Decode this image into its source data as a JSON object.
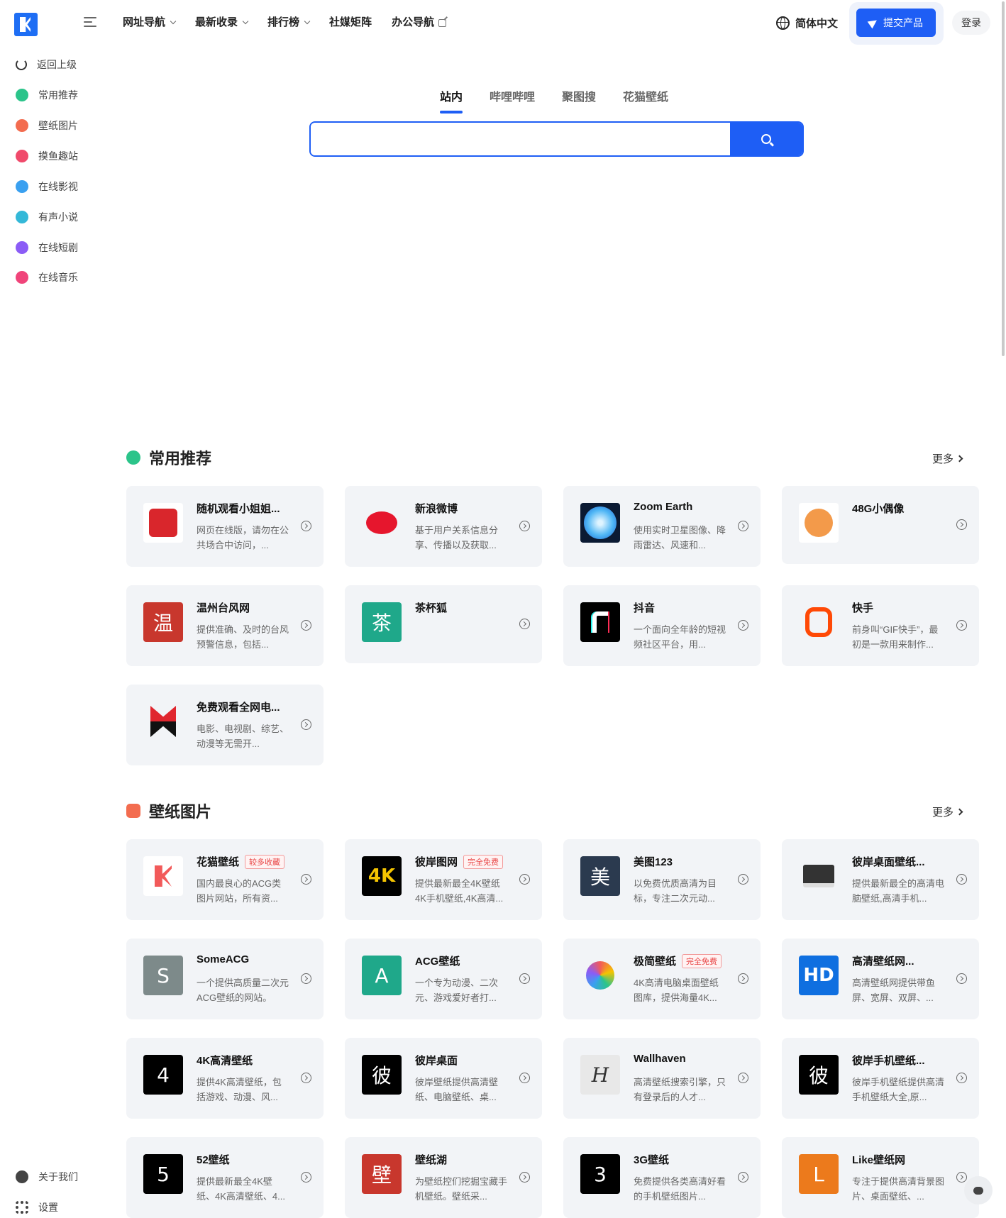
{
  "header": {
    "nav": [
      {
        "label": "网址导航",
        "type": "dropdown"
      },
      {
        "label": "最新收录",
        "type": "dropdown"
      },
      {
        "label": "排行榜",
        "type": "dropdown"
      },
      {
        "label": "社媒矩阵",
        "type": "plain"
      },
      {
        "label": "办公导航",
        "type": "external"
      }
    ],
    "language": "简体中文",
    "submit_label": "提交产品",
    "login_label": "登录"
  },
  "sidebar": {
    "items": [
      {
        "label": "返回上级",
        "icon": "back-arrow-icon",
        "color": "#333333"
      },
      {
        "label": "常用推荐",
        "icon": "verified-check-icon",
        "color": "#2bc48a"
      },
      {
        "label": "壁纸图片",
        "icon": "picture-icon",
        "color": "#f36c4f"
      },
      {
        "label": "摸鱼趣站",
        "icon": "fish-icon",
        "color": "#f04a6b"
      },
      {
        "label": "在线影视",
        "icon": "play-icon",
        "color": "#3aa0f0"
      },
      {
        "label": "有声小说",
        "icon": "chat-bubble-icon",
        "color": "#34b8d8"
      },
      {
        "label": "在线短剧",
        "icon": "tv-icon",
        "color": "#8b5cf6"
      },
      {
        "label": "在线音乐",
        "icon": "music-disc-icon",
        "color": "#f0447a"
      }
    ],
    "bottom": [
      {
        "label": "关于我们",
        "icon": "info-icon"
      },
      {
        "label": "设置",
        "icon": "gear-icon"
      }
    ]
  },
  "search": {
    "tabs": [
      "站内",
      "哔哩哔哩",
      "聚图搜",
      "花猫壁纸"
    ],
    "active_tab": 0,
    "placeholder": "",
    "value": ""
  },
  "sections": [
    {
      "title": "常用推荐",
      "icon": "verified-check-icon",
      "more_label": "更多",
      "cards": [
        {
          "title": "随机观看小姐姐...",
          "desc": "网页在线版，请勿在公共场合中访问，...",
          "icon_text": "",
          "icon_kind": "heart-app-icon",
          "icon_bg": "#ffffff"
        },
        {
          "title": "新浪微博",
          "desc": "基于用户关系信息分享、传播以及获取...",
          "icon_text": "",
          "icon_kind": "weibo-icon",
          "icon_bg": "#f2f4f7"
        },
        {
          "title": "Zoom Earth",
          "desc": "使用实时卫星图像、降雨雷达、风速和...",
          "icon_text": "",
          "icon_kind": "earth-swirl-icon",
          "icon_bg": "#0b1a33"
        },
        {
          "title": "48G小偶像",
          "desc": "",
          "icon_text": "",
          "icon_kind": "fox-mascot-icon",
          "icon_bg": "#ffffff"
        },
        {
          "title": "温州台风网",
          "desc": "提供准确、及时的台风预警信息，包括...",
          "icon_text": "温",
          "icon_kind": "letter-icon",
          "icon_bg": "#c8372d"
        },
        {
          "title": "茶杯狐",
          "desc": "",
          "icon_text": "茶",
          "icon_kind": "letter-icon",
          "icon_bg": "#1fa88a"
        },
        {
          "title": "抖音",
          "desc": "一个面向全年龄的短视频社区平台，用...",
          "icon_text": "",
          "icon_kind": "douyin-icon",
          "icon_bg": "#000000"
        },
        {
          "title": "快手",
          "desc": "前身叫“GIF快手”，最初是一款用来制作...",
          "icon_text": "",
          "icon_kind": "kuaishou-icon",
          "icon_bg": "#f2f4f7"
        },
        {
          "title": "免费观看全网电...",
          "desc": "电影、电视剧、综艺、动漫等无需开...",
          "icon_text": "",
          "icon_kind": "m-logo-icon",
          "icon_bg": "#f2f4f7"
        }
      ]
    },
    {
      "title": "壁纸图片",
      "icon": "picture-icon",
      "more_label": "更多",
      "cards": [
        {
          "title": "花猫壁纸",
          "badge": "较多收藏",
          "desc": "国内最良心的ACG类图片网站，所有资...",
          "icon_text": "",
          "icon_kind": "k-logo-icon",
          "icon_bg": "#ffffff"
        },
        {
          "title": "彼岸图网",
          "badge": "完全免费",
          "desc": "提供最新最全4K壁纸 4K手机壁纸,4K高清...",
          "icon_text": "4K",
          "icon_kind": "letter-icon",
          "icon_bg": "#000000"
        },
        {
          "title": "美图123",
          "desc": "以免费优质高清为目标，专注二次元动...",
          "icon_text": "美",
          "icon_kind": "letter-icon",
          "icon_bg": "#2b3a4f"
        },
        {
          "title": "彼岸桌面壁纸...",
          "desc": "提供最新最全的高清电脑壁纸,高清手机...",
          "icon_text": "",
          "icon_kind": "monitor-icon",
          "icon_bg": "#f2f4f7"
        },
        {
          "title": "SomeACG",
          "desc": "一个提供高质量二次元ACG壁纸的网站。",
          "icon_text": "S",
          "icon_kind": "letter-icon",
          "icon_bg": "#7d8a8a"
        },
        {
          "title": "ACG壁纸",
          "desc": "一个专为动漫、二次元、游戏爱好者打...",
          "icon_text": "A",
          "icon_kind": "letter-icon",
          "icon_bg": "#1fa88a"
        },
        {
          "title": "极简壁纸",
          "badge": "完全免费",
          "desc": "4K高清电脑桌面壁纸图库，提供海量4K...",
          "icon_text": "",
          "icon_kind": "color-ring-icon",
          "icon_bg": "#f2f4f7"
        },
        {
          "title": "高清壁纸网...",
          "desc": "高清壁纸网提供带鱼屏、宽屏、双屏、...",
          "icon_text": "HD",
          "icon_kind": "letter-icon",
          "icon_bg": "#0f6fe0"
        },
        {
          "title": "4K高清壁纸",
          "desc": "提供4K高清壁纸，包括游戏、动漫、风...",
          "icon_text": "4",
          "icon_kind": "letter-icon",
          "icon_bg": "#000000"
        },
        {
          "title": "彼岸桌面",
          "desc": "彼岸壁纸提供高清壁纸、电脑壁纸、桌...",
          "icon_text": "彼",
          "icon_kind": "letter-icon",
          "icon_bg": "#000000"
        },
        {
          "title": "Wallhaven",
          "desc": "高清壁纸搜索引擎，只有登录后的人才...",
          "icon_text": "H",
          "icon_kind": "script-h-icon",
          "icon_bg": "#e8e8e8"
        },
        {
          "title": "彼岸手机壁纸...",
          "desc": "彼岸手机壁纸提供高清手机壁纸大全,原...",
          "icon_text": "彼",
          "icon_kind": "letter-icon",
          "icon_bg": "#000000"
        },
        {
          "title": "52壁纸",
          "desc": "提供最新最全4K壁纸、4K高清壁纸、4...",
          "icon_text": "5",
          "icon_kind": "letter-icon",
          "icon_bg": "#000000"
        },
        {
          "title": "壁纸湖",
          "desc": "为壁纸控们挖掘宝藏手机壁纸。壁纸采...",
          "icon_text": "壁",
          "icon_kind": "letter-icon",
          "icon_bg": "#c8372d"
        },
        {
          "title": "3G壁纸",
          "desc": "免费提供各类高清好看的手机壁纸图片...",
          "icon_text": "3",
          "icon_kind": "letter-icon",
          "icon_bg": "#000000"
        },
        {
          "title": "Like壁纸网",
          "desc": "专注于提供高清背景图片、桌面壁纸、...",
          "icon_text": "L",
          "icon_kind": "letter-icon",
          "icon_bg": "#ec7a1c"
        }
      ]
    }
  ]
}
